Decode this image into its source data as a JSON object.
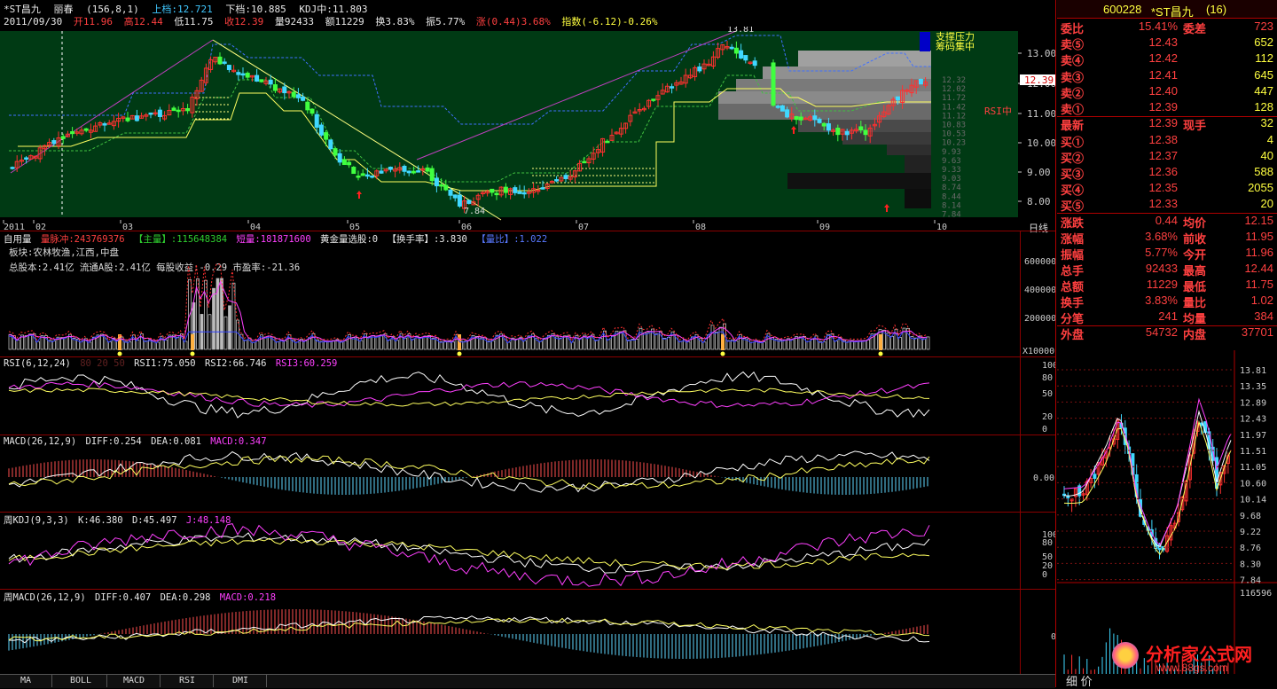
{
  "header": {
    "stock": "*ST昌九",
    "mode": "丽春",
    "params": "(156,8,1)",
    "upper_label": "上档:12.721",
    "lower_label": "下档:10.885",
    "kdj_label": "KDJ中:11.803"
  },
  "quote": {
    "date": "2011/09/30",
    "open": "开11.96",
    "high": "高12.44",
    "low": "低11.75",
    "close": "收12.39",
    "vol": "量92433",
    "amount": "额11229",
    "turnover": "换3.83%",
    "amp": "振5.77%",
    "change": "涨(0.44)3.68%",
    "index": "指数(-6.12)-0.26%"
  },
  "main_chart": {
    "price_axis": [
      "13.00",
      "12.00",
      "11.00",
      "10.00",
      "9.00",
      "8.00"
    ],
    "right_scale": [
      "12.32",
      "12.02",
      "11.72",
      "11.42",
      "11.12",
      "10.83",
      "10.53",
      "10.23",
      "9.93",
      "9.63",
      "9.33",
      "9.03",
      "8.74",
      "8.44",
      "8.14",
      "7.84"
    ],
    "annot_high": "13.81",
    "annot_low": "7.84",
    "legend_1": "支撑压力",
    "legend_2": "筹码集中",
    "rsi_tag": "RSI中",
    "price_tag": "12.39",
    "months": [
      "2011",
      "02",
      "03",
      "04",
      "05",
      "06",
      "07",
      "08",
      "09",
      "10"
    ],
    "period": "日线"
  },
  "vol_panel": {
    "title": "自用量",
    "t1": "量脉冲:243769376",
    "t2": "【主量】:115648384",
    "t3": "短量:181871600",
    "t4": "黄金量选股:0",
    "t5": "【换手率】:3.830",
    "t6": "【量比】:1.022",
    "info1": "板块:农林牧渔,江西,中盘",
    "info2": "总股本:2.41亿 流通A股:2.41亿 每股收益:-0.29 市盈率:-21.36",
    "axis": [
      "600000",
      "400000",
      "200000"
    ],
    "unit": "X10000"
  },
  "rsi_panel": {
    "title": "RSI(6,12,24)",
    "extra": "80 20 50",
    "r1": "RSI1:75.050",
    "r2": "RSI2:66.746",
    "r3": "RSI3:60.259",
    "axis": [
      "100",
      "80",
      "50",
      "20",
      "0"
    ]
  },
  "macd_panel": {
    "title": "MACD(26,12,9)",
    "diff": "DIFF:0.254",
    "dea": "DEA:0.081",
    "macd": "MACD:0.347",
    "axis": [
      "0.00"
    ]
  },
  "wkdj_panel": {
    "title": "周KDJ(9,3,3)",
    "k": "K:46.380",
    "d": "D:45.497",
    "j": "J:48.148",
    "axis": [
      "100",
      "80",
      "50",
      "20",
      "0"
    ]
  },
  "wmacd_panel": {
    "title": "周MACD(26,12,9)",
    "diff": "DIFF:0.407",
    "dea": "DEA:0.298",
    "macd": "MACD:0.218",
    "axis": [
      "0"
    ]
  },
  "tabs": [
    "MA",
    "BOLL",
    "MACD",
    "RSI",
    "DMI"
  ],
  "right_panel": {
    "code": "600228",
    "name": "*ST昌九",
    "suffix": "(16)",
    "rows": [
      {
        "l": "委比",
        "v1": "15.41%",
        "l2": "委差",
        "v2": "723",
        "c": "#ff4040"
      },
      {
        "l": "卖⑤",
        "v1": "12.43",
        "l2": "",
        "v2": "652",
        "c": "#ff4040"
      },
      {
        "l": "卖④",
        "v1": "12.42",
        "l2": "",
        "v2": "112",
        "c": "#ff4040"
      },
      {
        "l": "卖③",
        "v1": "12.41",
        "l2": "",
        "v2": "645",
        "c": "#ff4040"
      },
      {
        "l": "卖②",
        "v1": "12.40",
        "l2": "",
        "v2": "447",
        "c": "#ff4040"
      },
      {
        "l": "卖①",
        "v1": "12.39",
        "l2": "",
        "v2": "128",
        "c": "#ff4040"
      },
      {
        "l": "最新",
        "v1": "12.39",
        "l2": "现手",
        "v2": "32",
        "c": "#ff4040"
      },
      {
        "l": "买①",
        "v1": "12.38",
        "l2": "",
        "v2": "4",
        "c": "#ff4040"
      },
      {
        "l": "买②",
        "v1": "12.37",
        "l2": "",
        "v2": "40",
        "c": "#ff4040"
      },
      {
        "l": "买③",
        "v1": "12.36",
        "l2": "",
        "v2": "588",
        "c": "#ff4040"
      },
      {
        "l": "买④",
        "v1": "12.35",
        "l2": "",
        "v2": "2055",
        "c": "#ff4040"
      },
      {
        "l": "买⑤",
        "v1": "12.33",
        "l2": "",
        "v2": "20",
        "c": "#ff4040"
      },
      {
        "l": "涨跌",
        "v1": "0.44",
        "l2": "均价",
        "v2": "12.15",
        "c": "#ff4040"
      },
      {
        "l": "涨幅",
        "v1": "3.68%",
        "l2": "前收",
        "v2": "11.95",
        "c": "#ff4040"
      },
      {
        "l": "振幅",
        "v1": "5.77%",
        "l2": "今开",
        "v2": "11.96",
        "c": "#ff4040"
      },
      {
        "l": "总手",
        "v1": "92433",
        "l2": "最高",
        "v2": "12.44",
        "c": "#ff4040"
      },
      {
        "l": "总额",
        "v1": "11229",
        "l2": "最低",
        "v2": "11.75",
        "c": "#ff4040"
      },
      {
        "l": "换手",
        "v1": "3.83%",
        "l2": "量比",
        "v2": "1.02",
        "c": "#ff4040"
      },
      {
        "l": "分笔",
        "v1": "241",
        "l2": "均量",
        "v2": "384",
        "c": "#ff4040"
      },
      {
        "l": "外盘",
        "v1": "54732",
        "l2": "内盘",
        "v2": "37701",
        "c": "#ff4040"
      }
    ],
    "mini_axis": [
      "13.81",
      "13.35",
      "12.89",
      "12.43",
      "11.97",
      "11.51",
      "11.05",
      "10.60",
      "10.14",
      "9.68",
      "9.22",
      "8.76",
      "8.30",
      "7.84"
    ],
    "mini_vol": "116596",
    "bottom_label": "细 价",
    "watermark": "分析家公式网",
    "watermark_url": "www.88gs.com"
  }
}
